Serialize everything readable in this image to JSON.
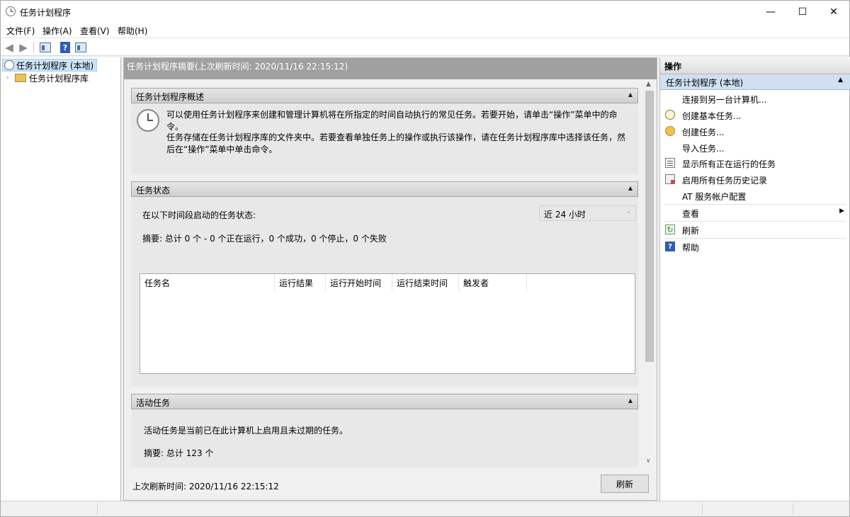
{
  "window": {
    "title": "任务计划程序",
    "minimize_glyph": "—",
    "maximize_glyph": "☐",
    "close_glyph": "✕"
  },
  "menu": [
    "文件(F)",
    "操作(A)",
    "查看(V)",
    "帮助(H)"
  ],
  "toolbar": {
    "back_icon": "◀",
    "forward_icon": "▶",
    "help_icon": "?"
  },
  "tree": {
    "root_label": "任务计划程序 (本地)",
    "child_label": "任务计划程序库",
    "child_caret": "›"
  },
  "center": {
    "header": "任务计划程序摘要(上次刷新时间: 2020/11/16 22:15:12)",
    "overview": {
      "title": "任务计划程序概述",
      "para1": "可以使用任务计划程序来创建和管理计算机将在所指定的时间自动执行的常见任务。若要开始，请单击“操作”菜单中的命令。",
      "para2": "任务存储在任务计划程序库的文件夹中。若要查看单独任务上的操作或执行该操作，请在任务计划程序库中选择该任务，然后在“操作”菜单中单击命令。"
    },
    "status": {
      "title": "任务状态",
      "period_label": "在以下时间段启动的任务状态:",
      "period_value": "近 24 小时",
      "summary": "摘要: 总计 0 个 - 0 个正在运行，0 个成功，0 个停止，0 个失败",
      "columns": [
        "任务名",
        "运行结果",
        "运行开始时间",
        "运行结束时间",
        "触发者"
      ]
    },
    "active": {
      "title": "活动任务",
      "description": "活动任务是当前已在此计算机上启用且未过期的任务。",
      "summary": "摘要: 总计 123 个"
    },
    "collapse_glyph": "▲",
    "footer_text": "上次刷新时间: 2020/11/16 22:15:12",
    "refresh_button": "刷新",
    "scroll_up": "▲",
    "scroll_down": "∨"
  },
  "actions_panel": {
    "header": "操作",
    "group_title": "任务计划程序 (本地)",
    "group_caret": "▲",
    "items": [
      {
        "label": "连接到另一台计算机...",
        "icon": "none"
      },
      {
        "label": "创建基本任务...",
        "icon": "clock-icon"
      },
      {
        "label": "创建任务...",
        "icon": "task-icon"
      },
      {
        "label": "导入任务...",
        "icon": "none"
      },
      {
        "label": "显示所有正在运行的任务",
        "icon": "list-icon"
      },
      {
        "label": "启用所有任务历史记录",
        "icon": "history-icon"
      },
      {
        "label": "AT 服务帐户配置",
        "icon": "none"
      },
      {
        "label": "查看",
        "icon": "none"
      },
      {
        "label": "刷新",
        "icon": "refresh-icon"
      },
      {
        "label": "帮助",
        "icon": "help-icon"
      }
    ],
    "submenu_arrow": "▶",
    "refresh_glyph": "↻",
    "help_glyph": "?"
  }
}
